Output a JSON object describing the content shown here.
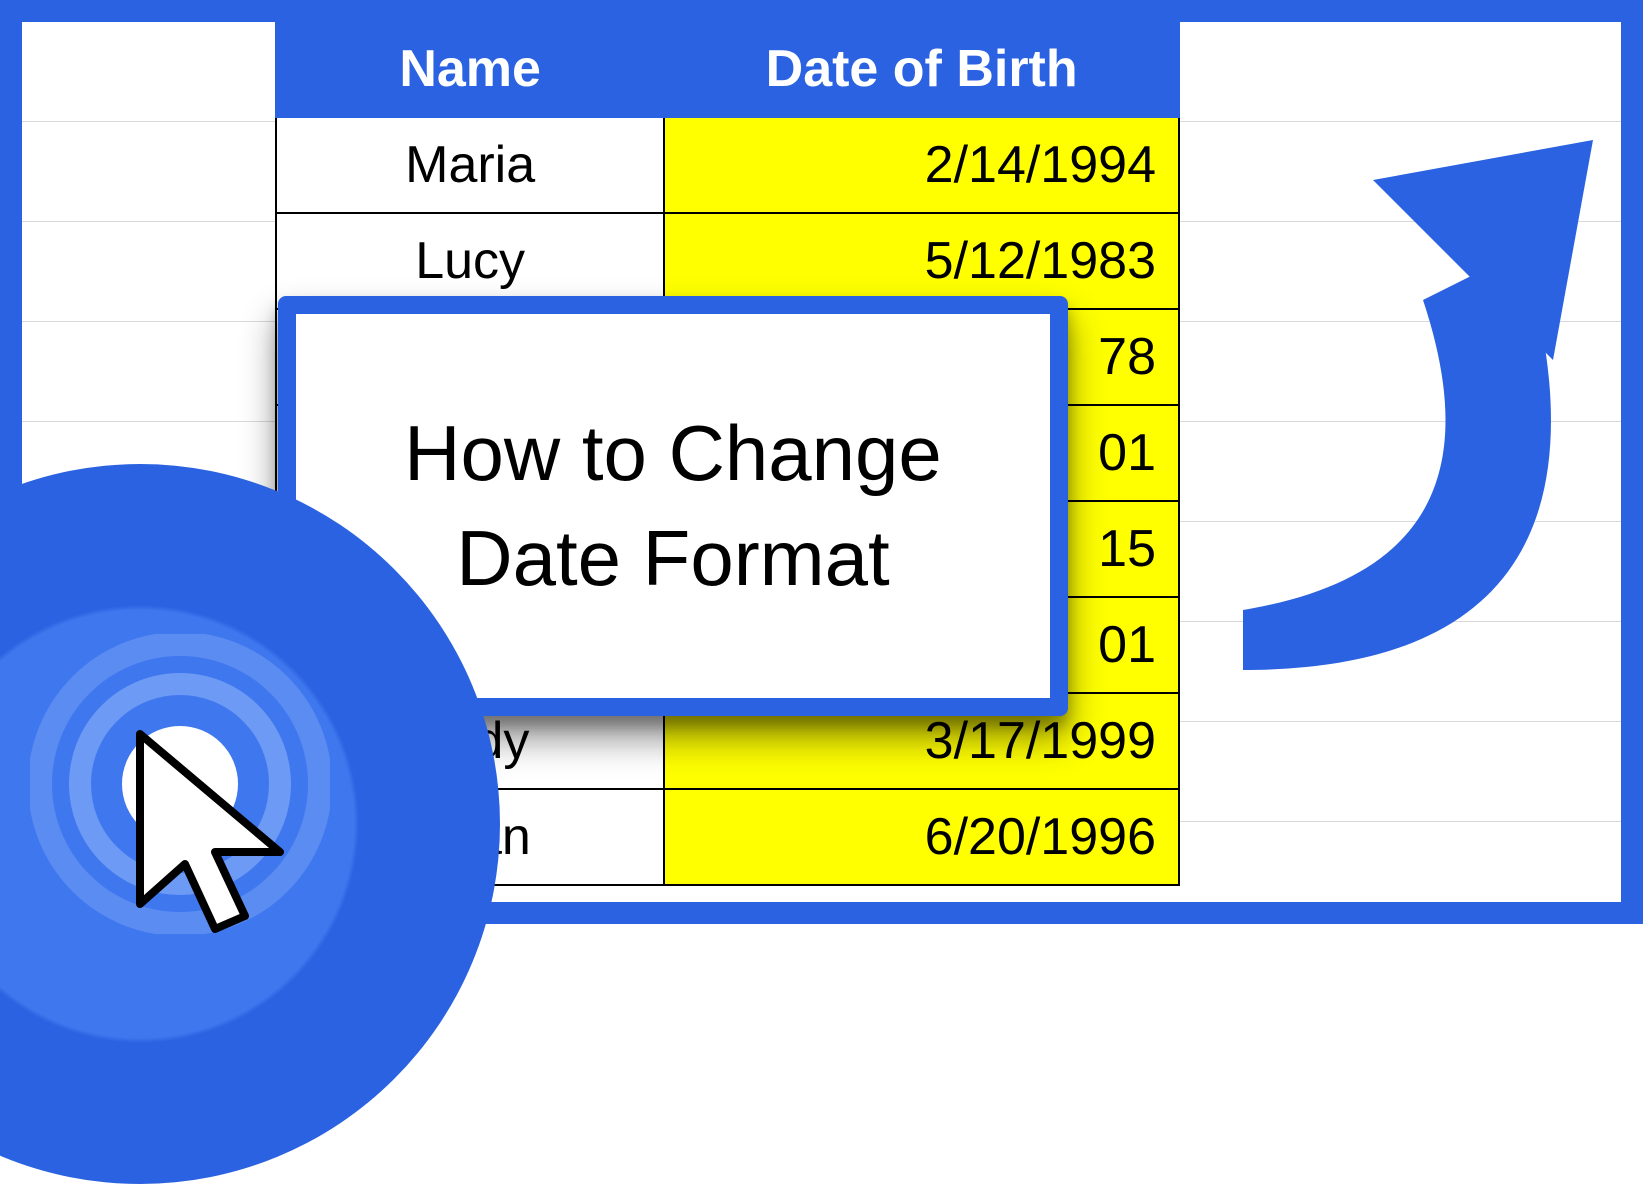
{
  "colors": {
    "primary": "#2a62e1",
    "highlight": "#ffff00"
  },
  "table": {
    "headers": {
      "name": "Name",
      "dob": "Date of Birth"
    },
    "rows": [
      {
        "name": "Maria",
        "dob": "2/14/1994"
      },
      {
        "name": "Lucy",
        "dob": "5/12/1983"
      },
      {
        "name": "",
        "dob": "78"
      },
      {
        "name": "",
        "dob": "01"
      },
      {
        "name": "",
        "dob": "15"
      },
      {
        "name": "",
        "dob": "01"
      },
      {
        "name": "Andy",
        "dob": "3/17/1999"
      },
      {
        "name": "Ryan",
        "dob": "6/20/1996"
      }
    ]
  },
  "overlay": {
    "title_line1": "How to Change",
    "title_line2": "Date Format"
  },
  "icons": {
    "arrow": "curved-arrow-icon",
    "cursor": "cursor-click-icon",
    "rings": "target-rings-icon"
  }
}
